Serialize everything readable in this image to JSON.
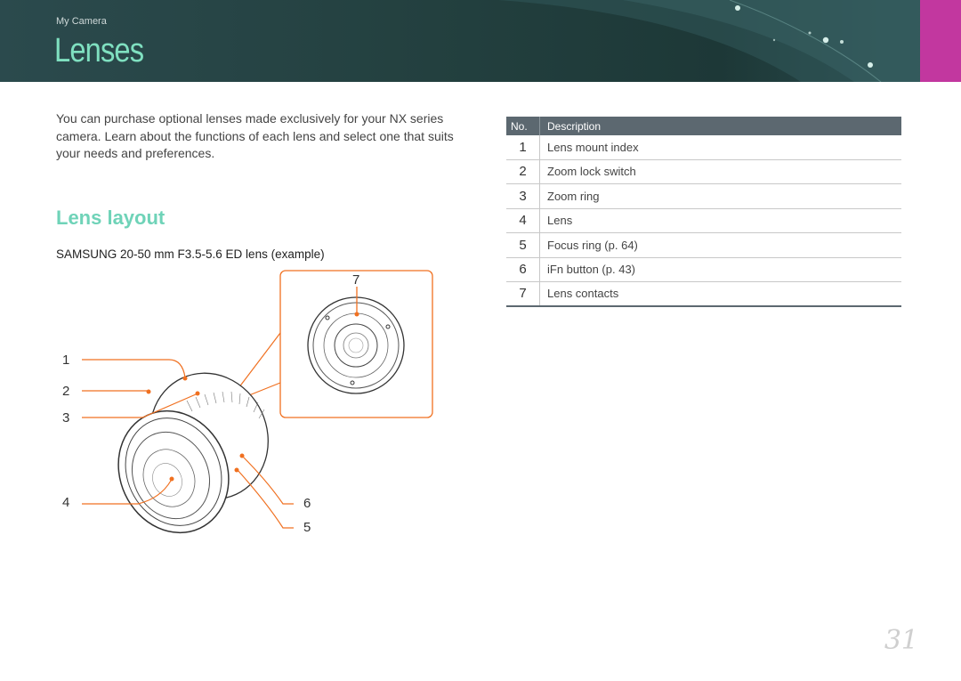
{
  "header": {
    "breadcrumb": "My Camera",
    "title": "Lenses",
    "accent_color": "#c2379f",
    "background_color": "#23403f"
  },
  "intro_text": "You can purchase optional lenses made exclusively for your NX series camera. Learn about the functions of each lens and select one that suits your needs and preferences.",
  "section": {
    "title": "Lens layout",
    "caption": "SAMSUNG 20-50 mm F3.5-5.6 ED lens (example)"
  },
  "figure": {
    "callouts": [
      "1",
      "2",
      "3",
      "4",
      "5",
      "6",
      "7"
    ]
  },
  "table": {
    "header_no": "No.",
    "header_desc": "Description",
    "rows": [
      {
        "no": "1",
        "desc": "Lens mount index"
      },
      {
        "no": "2",
        "desc": "Zoom lock switch"
      },
      {
        "no": "3",
        "desc": "Zoom ring"
      },
      {
        "no": "4",
        "desc": "Lens"
      },
      {
        "no": "5",
        "desc": "Focus ring (p. 64)"
      },
      {
        "no": "6",
        "desc": "iFn button (p. 43)"
      },
      {
        "no": "7",
        "desc": "Lens contacts"
      }
    ]
  },
  "page_number": "31"
}
